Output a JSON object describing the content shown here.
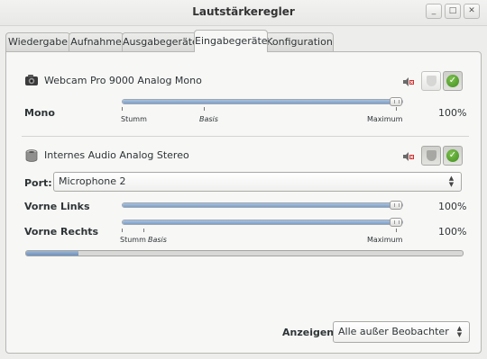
{
  "window": {
    "title": "Lautstärkeregler",
    "controls": [
      "_",
      "□",
      "✕"
    ]
  },
  "tabs": [
    {
      "label": "Wiedergabe",
      "active": false
    },
    {
      "label": "Aufnahme",
      "active": false
    },
    {
      "label": "Ausgabegeräte",
      "active": false
    },
    {
      "label": "Eingabegeräte",
      "active": true
    },
    {
      "label": "Konfiguration",
      "active": false
    }
  ],
  "devices": [
    {
      "name": "Webcam Pro 9000 Analog Mono",
      "channels": [
        {
          "label": "Mono",
          "percent": "100%",
          "level": 1.0
        }
      ],
      "scale": {
        "min": "Stumm",
        "base": "Basis",
        "max": "Maximum"
      },
      "locked": false,
      "default": true
    },
    {
      "name": "Internes Audio Analog Stereo",
      "port_label": "Port:",
      "port_value": "Microphone 2",
      "channels": [
        {
          "label": "Vorne Links",
          "percent": "100%",
          "level": 1.0
        },
        {
          "label": "Vorne Rechts",
          "percent": "100%",
          "level": 1.0
        }
      ],
      "scale": {
        "min": "Stumm",
        "base": "Basis",
        "max": "Maximum"
      },
      "locked": true,
      "default": true,
      "peak_level": 0.12
    }
  ],
  "footer": {
    "show_label": "Anzeigen:",
    "show_value": "Alle außer Beobachter"
  },
  "icons": {
    "mute": "speaker-mute-icon",
    "lock": "lock-channels-icon",
    "default": "set-default-icon",
    "accent_green": "#4a9e23",
    "accent_blue": "#7e9fc7"
  }
}
